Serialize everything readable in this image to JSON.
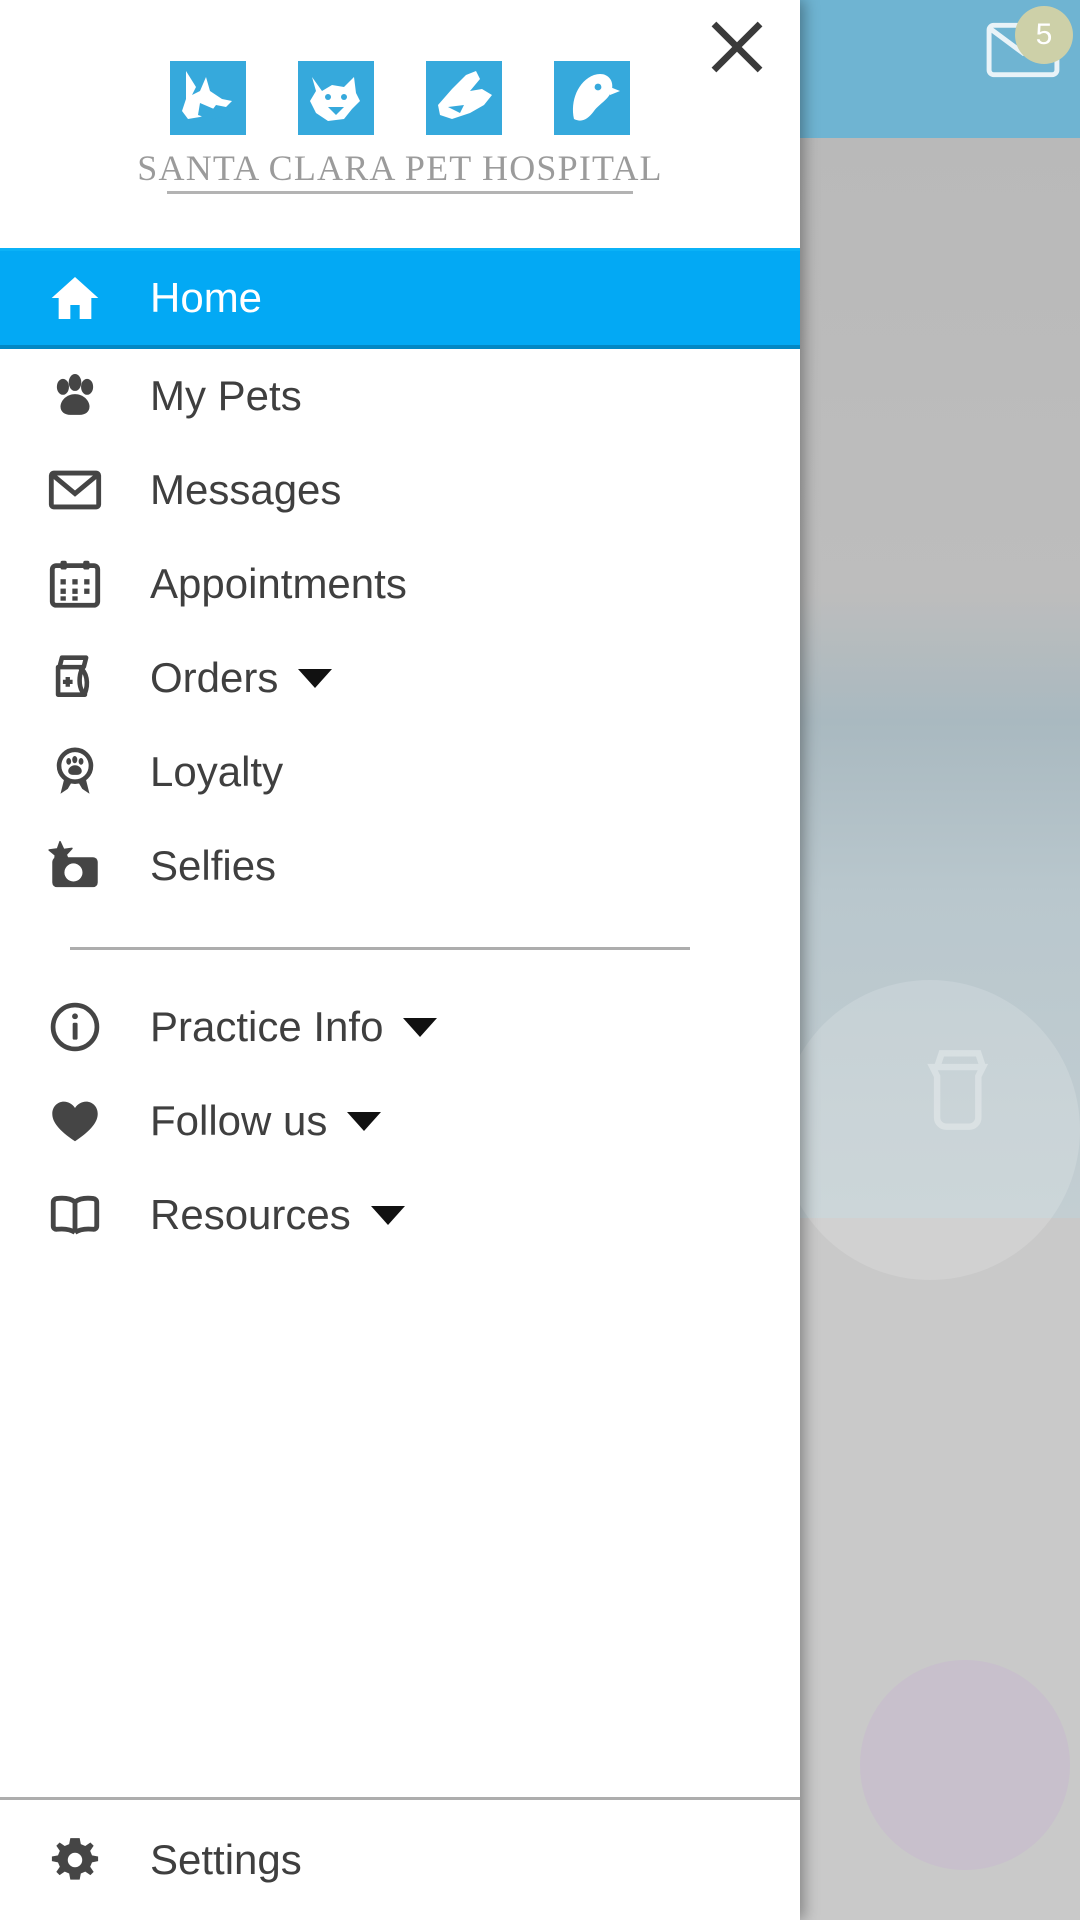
{
  "backdrop": {
    "mail_icon": "mail-icon",
    "badge_count": "5"
  },
  "drawer": {
    "close_label": "close-icon",
    "logo": {
      "name": "SANTA CLARA PET HOSPITAL",
      "tiles": [
        "dog-head-icon",
        "cat-head-icon",
        "rabbit-head-icon",
        "bird-head-icon"
      ],
      "tile_color": "#36a9dc",
      "text_color": "#9b9b9b"
    },
    "accent_color": "#03a9f4",
    "nav_primary": [
      {
        "label": "Home",
        "icon": "home-icon",
        "active": true,
        "has_caret": false
      },
      {
        "label": "My Pets",
        "icon": "paw-icon",
        "active": false,
        "has_caret": false
      },
      {
        "label": "Messages",
        "icon": "envelope-icon",
        "active": false,
        "has_caret": false
      },
      {
        "label": "Appointments",
        "icon": "calendar-icon",
        "active": false,
        "has_caret": false
      },
      {
        "label": "Orders",
        "icon": "food-bag-icon",
        "active": false,
        "has_caret": true
      },
      {
        "label": "Loyalty",
        "icon": "award-paw-icon",
        "active": false,
        "has_caret": false
      },
      {
        "label": "Selfies",
        "icon": "camera-star-icon",
        "active": false,
        "has_caret": false
      }
    ],
    "nav_secondary": [
      {
        "label": "Practice Info",
        "icon": "info-circle-icon",
        "active": false,
        "has_caret": true
      },
      {
        "label": "Follow us",
        "icon": "heart-icon",
        "active": false,
        "has_caret": true
      },
      {
        "label": "Resources",
        "icon": "book-icon",
        "active": false,
        "has_caret": true
      }
    ],
    "nav_footer": [
      {
        "label": "Settings",
        "icon": "gear-icon",
        "active": false,
        "has_caret": false
      }
    ]
  }
}
